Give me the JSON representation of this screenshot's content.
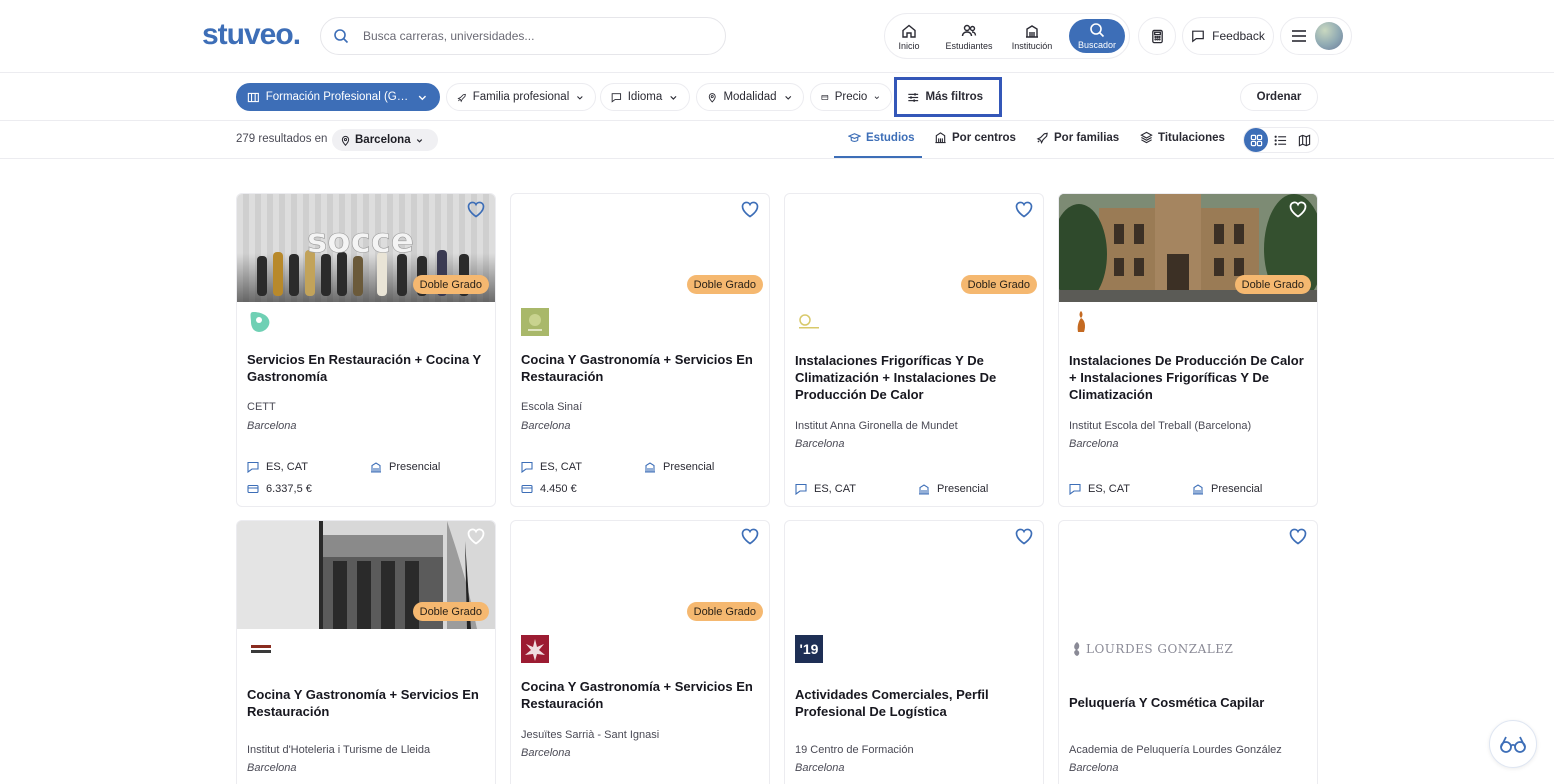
{
  "header": {
    "logo": "stuveo.",
    "search_placeholder": "Busca carreras, universidades...",
    "nav": {
      "inicio": "Inicio",
      "estudiantes": "Estudiantes",
      "institucion": "Institución",
      "buscador": "Buscador"
    },
    "feedback": "Feedback"
  },
  "filters": {
    "primary": "Formación Profesional (Grado Superior)",
    "familia": "Familia profesional",
    "idioma": "Idioma",
    "modalidad": "Modalidad",
    "precio": "Precio",
    "mas": "Más filtros",
    "ordenar": "Ordenar"
  },
  "results": {
    "count_text": "279 resultados en",
    "city": "Barcelona",
    "tabs": {
      "estudios": "Estudios",
      "centros": "Por centros",
      "familias": "Por familias",
      "titulaciones": "Titulaciones"
    }
  },
  "colors": {
    "brand": "#3d6eb7",
    "badge": "#f5b870",
    "highlight": "#3457b8"
  },
  "cards": [
    {
      "badge": "Doble Grado",
      "title": "Servicios En Restauración + Cocina Y Gastronomía",
      "center": "CETT",
      "city": "Barcelona",
      "lang": "ES, CAT",
      "mode": "Presencial",
      "price": "6.337,5 €",
      "logo_label": ""
    },
    {
      "badge": "Doble Grado",
      "title": "Cocina Y Gastronomía + Servicios En Restauración",
      "center": "Escola Sinaí",
      "city": "Barcelona",
      "lang": "ES, CAT",
      "mode": "Presencial",
      "price": "4.450 €",
      "logo_label": ""
    },
    {
      "badge": "Doble Grado",
      "title": "Instalaciones Frigoríficas Y De Climatización + Instalaciones De Producción De Calor",
      "center": "Institut Anna Gironella de Mundet",
      "city": "Barcelona",
      "lang": "ES, CAT",
      "mode": "Presencial",
      "logo_label": ""
    },
    {
      "badge": "Doble Grado",
      "title": "Instalaciones De Producción De Calor + Instalaciones Frigoríficas Y De Climatización",
      "center": "Institut Escola del Treball (Barcelona)",
      "city": "Barcelona",
      "lang": "ES, CAT",
      "mode": "Presencial",
      "logo_label": ""
    },
    {
      "badge": "Doble Grado",
      "title": "Cocina Y Gastronomía + Servicios En Restauración",
      "center": "Institut d'Hoteleria i Turisme de Lleida",
      "city": "Barcelona",
      "logo_label": ""
    },
    {
      "badge": "Doble Grado",
      "title": "Cocina Y Gastronomía + Servicios En Restauración",
      "center": "Jesuïtes Sarrià - Sant Ignasi",
      "city": "Barcelona",
      "logo_label": ""
    },
    {
      "title": "Actividades Comerciales, Perfil Profesional De Logística",
      "center": "19 Centro de Formación",
      "city": "Barcelona",
      "logo_label": "'19"
    },
    {
      "title": "Peluquería Y Cosmética Capilar",
      "center": "Academia de Peluquería Lourdes González",
      "city": "Barcelona",
      "logo_label": "LOURDES GONZALEZ"
    }
  ]
}
